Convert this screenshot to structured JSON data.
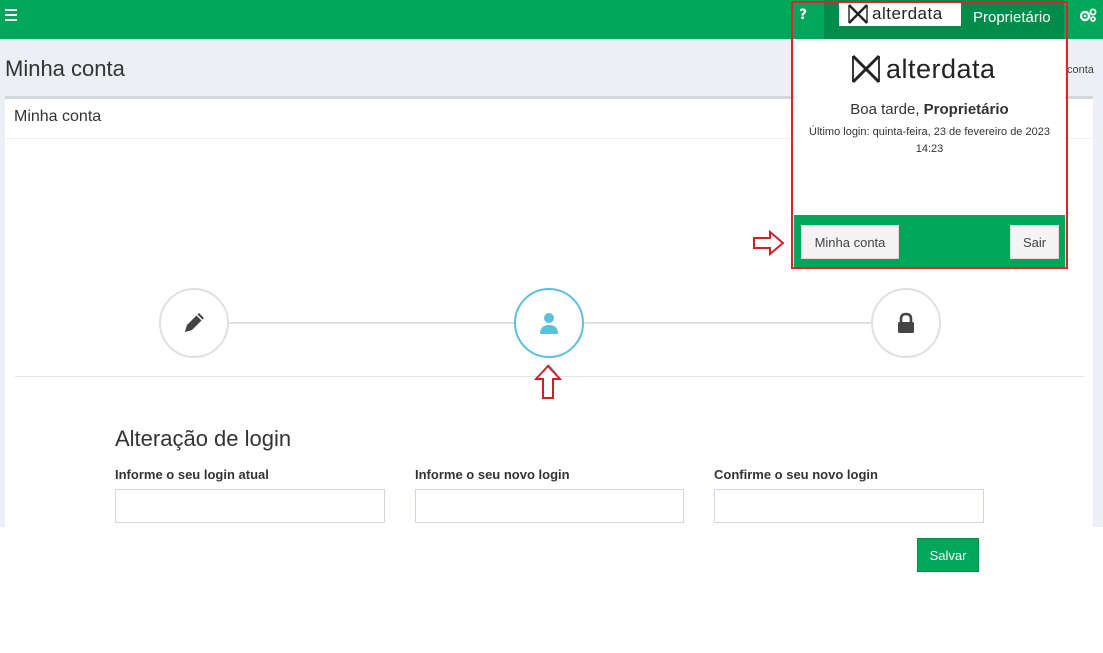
{
  "topbar": {
    "help_label": "?",
    "user_name": "Proprietário",
    "brand_name": "alterdata"
  },
  "page": {
    "title": "Minha conta",
    "breadcrumb": "conta"
  },
  "box": {
    "title": "Minha conta"
  },
  "steps": [
    {
      "icon": "pencil-icon",
      "active": false
    },
    {
      "icon": "user-icon",
      "active": true
    },
    {
      "icon": "lock-icon",
      "active": false
    }
  ],
  "form": {
    "title": "Alteração de login",
    "fields": [
      {
        "label": "Informe o seu login atual",
        "value": "",
        "placeholder": ""
      },
      {
        "label": "Informe o seu novo login",
        "value": "",
        "placeholder": ""
      },
      {
        "label": "Confirme o seu novo login",
        "value": "",
        "placeholder": ""
      }
    ],
    "save_label": "Salvar"
  },
  "dropdown": {
    "brand_name": "alterdata",
    "greeting_prefix": "Boa tarde,",
    "user_name": "Proprietário",
    "last_login_line1": "Último login: quinta-feira, 23 de fevereiro de 2023",
    "last_login_line2": "14:23",
    "account_button": "Minha conta",
    "logout_button": "Sair"
  },
  "colors": {
    "primary_green": "#00a65a",
    "dark_green": "#008d4c",
    "step_active": "#5bc0de",
    "annotation_red": "#e0232b"
  }
}
